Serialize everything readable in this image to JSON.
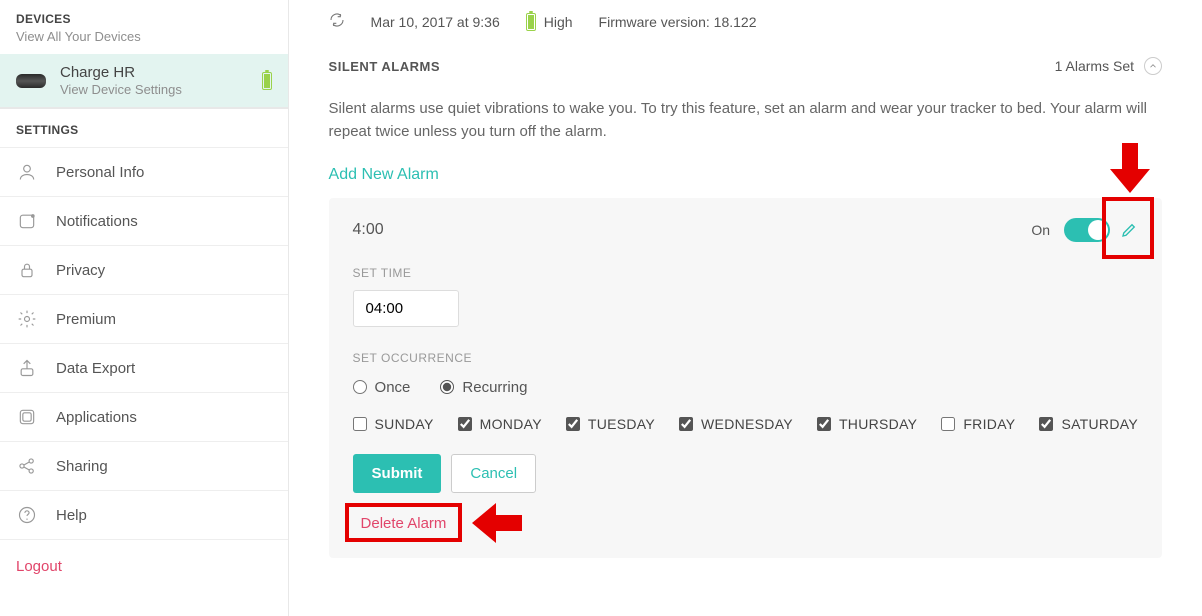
{
  "sidebar": {
    "devices_label": "DEVICES",
    "devices_sub": "View All Your Devices",
    "device": {
      "name": "Charge HR",
      "sub": "View Device Settings"
    },
    "settings_label": "SETTINGS",
    "items": [
      {
        "id": "personal",
        "label": "Personal Info"
      },
      {
        "id": "notifications",
        "label": "Notifications"
      },
      {
        "id": "privacy",
        "label": "Privacy"
      },
      {
        "id": "premium",
        "label": "Premium"
      },
      {
        "id": "export",
        "label": "Data Export"
      },
      {
        "id": "applications",
        "label": "Applications"
      },
      {
        "id": "sharing",
        "label": "Sharing"
      },
      {
        "id": "help",
        "label": "Help"
      }
    ],
    "logout": "Logout"
  },
  "status": {
    "sync": "Mar 10, 2017 at 9:36",
    "battery_label": "High",
    "firmware_label": "Firmware version: 18.122"
  },
  "alarms": {
    "section_title": "SILENT ALARMS",
    "count_label": "1 Alarms Set",
    "description": "Silent alarms use quiet vibrations to wake you. To try this feature, set an alarm and wear your tracker to bed. Your alarm will repeat twice unless you turn off the alarm.",
    "add_label": "Add New Alarm",
    "time_display": "4:00",
    "toggle_label": "On",
    "set_time_label": "SET TIME",
    "time_value": "04:00",
    "occurrence_label": "SET OCCURRENCE",
    "occ_once": "Once",
    "occ_recur": "Recurring",
    "days": [
      {
        "label": "SUNDAY",
        "checked": false
      },
      {
        "label": "MONDAY",
        "checked": true
      },
      {
        "label": "TUESDAY",
        "checked": true
      },
      {
        "label": "WEDNESDAY",
        "checked": true
      },
      {
        "label": "THURSDAY",
        "checked": true
      },
      {
        "label": "FRIDAY",
        "checked": false
      },
      {
        "label": "SATURDAY",
        "checked": true
      }
    ],
    "submit": "Submit",
    "cancel": "Cancel",
    "delete": "Delete Alarm"
  },
  "colors": {
    "accent": "#2cbfb2",
    "danger": "#e1456a",
    "highlight": "#e40000"
  }
}
